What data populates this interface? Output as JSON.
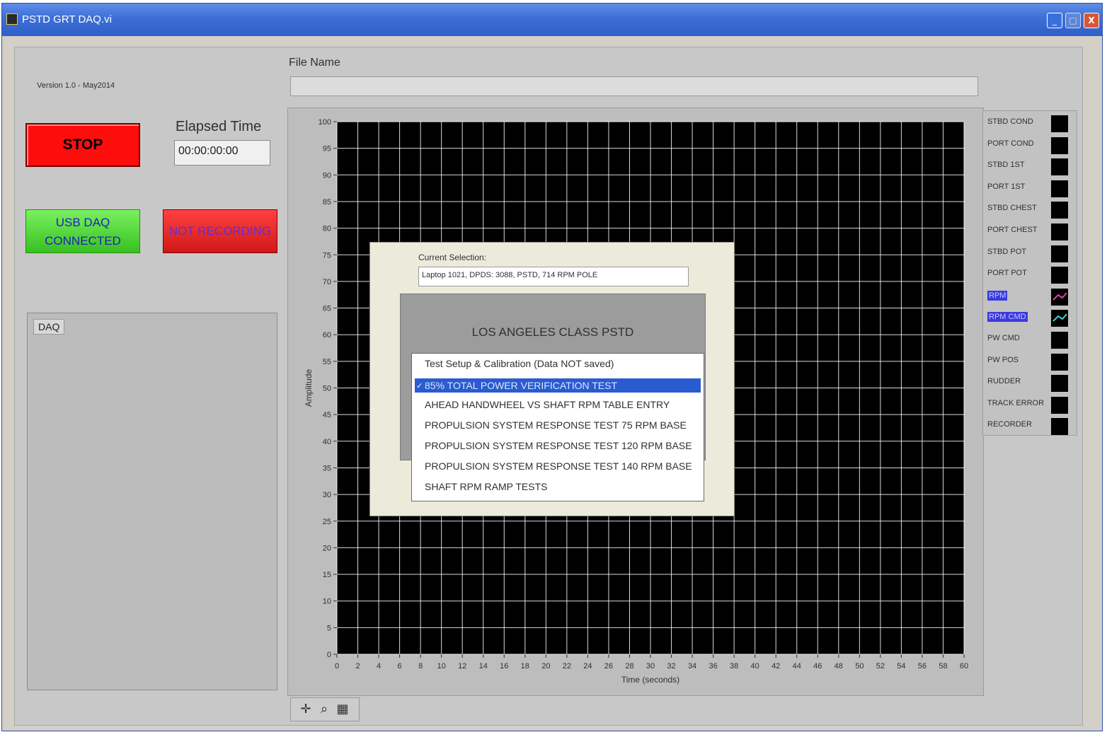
{
  "window": {
    "title": "PSTD GRT DAQ.vi",
    "minimize": "_",
    "maximize": "□",
    "close": "X"
  },
  "version": "Version 1.0 - May2014",
  "file": {
    "label": "File Name",
    "value": ""
  },
  "controls": {
    "stop_label": "STOP",
    "elapsed_label": "Elapsed Time",
    "elapsed_value": "00:00:00:00",
    "usb_line1": "USB DAQ",
    "usb_line2": "CONNECTED",
    "recording_label": "NOT RECORDING"
  },
  "daq": {
    "tab_label": "DAQ"
  },
  "chart_data": {
    "type": "line",
    "title": "",
    "xlabel": "Time (seconds)",
    "ylabel": "Amplitude",
    "xlim": [
      0,
      60
    ],
    "ylim": [
      0,
      100
    ],
    "x_ticks": [
      0,
      2,
      4,
      6,
      8,
      10,
      12,
      14,
      16,
      18,
      20,
      22,
      24,
      26,
      28,
      30,
      32,
      34,
      36,
      38,
      40,
      42,
      44,
      46,
      48,
      50,
      52,
      54,
      56,
      58,
      60
    ],
    "y_ticks": [
      0,
      5,
      10,
      15,
      20,
      25,
      30,
      35,
      40,
      45,
      50,
      55,
      60,
      65,
      70,
      75,
      80,
      85,
      90,
      95,
      100
    ],
    "grid": true,
    "background": "#000000",
    "grid_color": "#ffffff",
    "series": []
  },
  "legend": [
    {
      "name": "STBD COND",
      "color": "#000000"
    },
    {
      "name": "PORT COND",
      "color": "#000000"
    },
    {
      "name": "STBD 1ST",
      "color": "#000000"
    },
    {
      "name": "PORT 1ST",
      "color": "#000000"
    },
    {
      "name": "STBD CHEST",
      "color": "#000000"
    },
    {
      "name": "PORT CHEST",
      "color": "#000000"
    },
    {
      "name": "STBD POT",
      "color": "#000000"
    },
    {
      "name": "PORT POT",
      "color": "#000000"
    },
    {
      "name": "RPM",
      "color": "#e040a0",
      "selected": true
    },
    {
      "name": "RPM CMD",
      "color": "#40d0d0",
      "selected": true
    },
    {
      "name": "PW CMD",
      "color": "#000000"
    },
    {
      "name": "PW POS",
      "color": "#000000"
    },
    {
      "name": "RUDDER",
      "color": "#000000"
    },
    {
      "name": "TRACK ERROR",
      "color": "#000000"
    },
    {
      "name": "RECORDER",
      "color": "#000000"
    }
  ],
  "tools": {
    "cursor": "✛",
    "zoom": "⌕",
    "pan": "▦"
  },
  "dialog": {
    "current_label": "Current Selection:",
    "current_value": "Laptop 1021, DPDS: 3088, PSTD, 714 RPM POLE",
    "header": "LOS ANGELES CLASS PSTD",
    "items": [
      "Test Setup & Calibration (Data NOT saved)",
      "85% TOTAL POWER VERIFICATION TEST",
      "AHEAD HANDWHEEL VS SHAFT RPM TABLE ENTRY",
      "PROPULSION SYSTEM RESPONSE TEST 75 RPM BASE",
      "PROPULSION SYSTEM RESPONSE TEST 120 RPM BASE",
      "PROPULSION SYSTEM RESPONSE TEST 140 RPM BASE",
      "SHAFT RPM RAMP TESTS"
    ],
    "selected_index": 1,
    "check_mark": "✓"
  }
}
